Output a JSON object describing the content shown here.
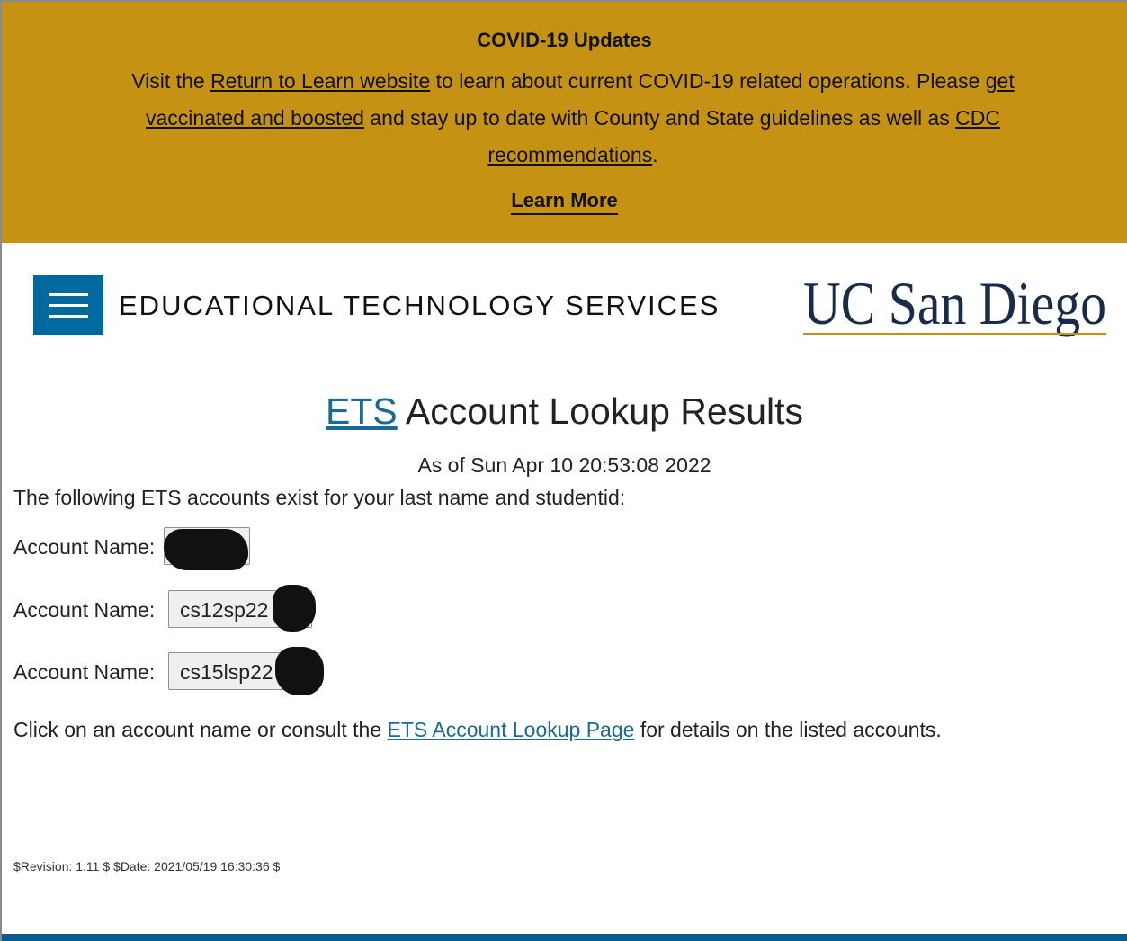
{
  "banner": {
    "title": "COVID-19 Updates",
    "text_before_link1": "Visit the ",
    "link1": "Return to Learn website",
    "text_after_link1": " to learn about current COVID-19 related operations. Please ",
    "link2": "get vaccinated and boosted",
    "text_after_link2": " and stay up to date with County and State guidelines as well as ",
    "link3": "CDC recommendations",
    "text_end": ".",
    "learn_more": "Learn More",
    "background_color": "#c59214"
  },
  "header": {
    "site_name": "EDUCATIONAL TECHNOLOGY SERVICES",
    "logo_text": "UC San Diego",
    "menu_icon": "hamburger-menu-icon",
    "accent_color": "#006a9e"
  },
  "main": {
    "title_link": "ETS",
    "title_rest": " Account Lookup Results",
    "as_of": "As of Sun Apr 10 20:53:08 2022",
    "intro": "The following ETS accounts exist for your last name and studentid:",
    "accounts": [
      {
        "label": "Account Name:",
        "value": ""
      },
      {
        "label": "Account Name:",
        "value": "cs12sp22"
      },
      {
        "label": "Account Name:",
        "value": "cs15lsp22"
      }
    ],
    "closing_before": "Click on an account name or consult the ",
    "closing_link": "ETS Account Lookup Page",
    "closing_after": " for details on the listed accounts.",
    "link_color": "#1a6a96"
  },
  "footer": {
    "revision": "$Revision: 1.11 $ $Date: 2021/05/19 16:30:36 $"
  }
}
